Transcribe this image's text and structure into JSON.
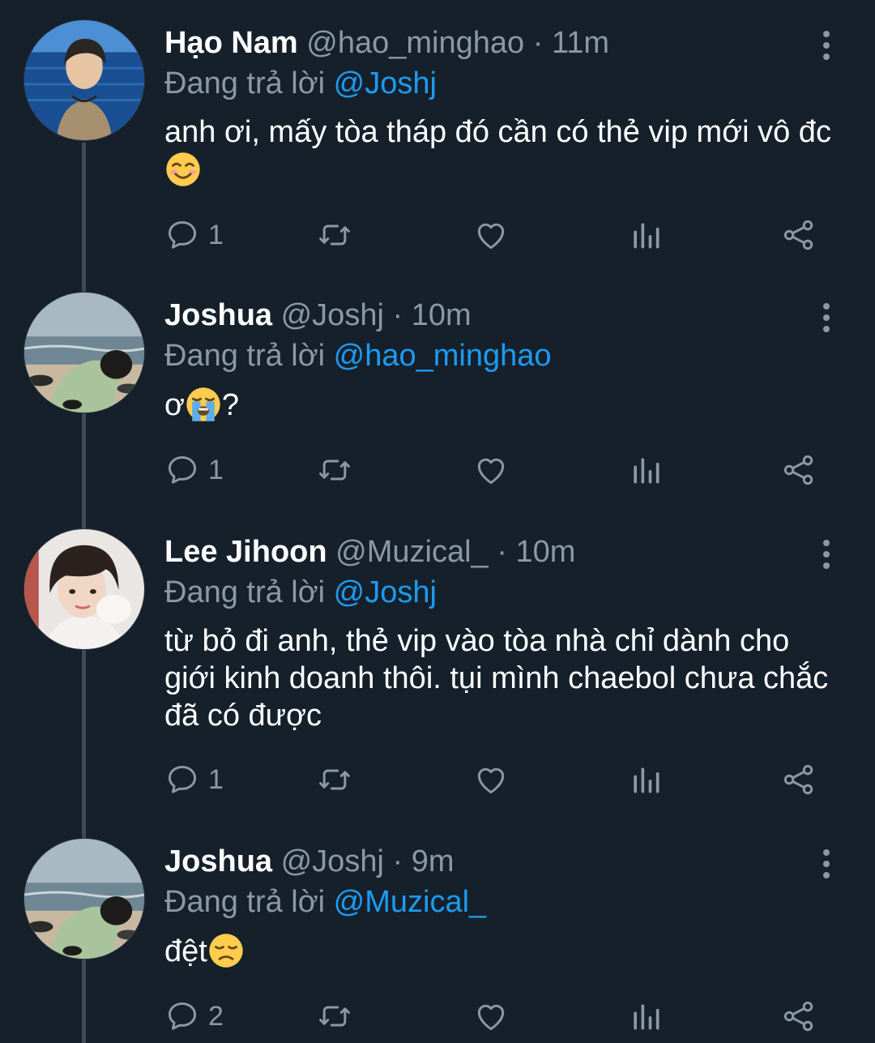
{
  "reply_prefix": "Đang trả lời",
  "dot": "·",
  "tweets": [
    {
      "name": "Hạo Nam",
      "handle": "@hao_minghao",
      "time": "11m",
      "reply_to": "@Joshj",
      "text": "anh ơi, mấy tòa tháp đó cần có thẻ vip mới vô đc",
      "emoji": "smiling-face-emoji",
      "reply_count": "1"
    },
    {
      "name": "Joshua",
      "handle": "@Joshj",
      "time": "10m",
      "reply_to": "@hao_minghao",
      "text_before": "ơ",
      "emoji": "crying-face-emoji",
      "text_after": "?",
      "reply_count": "1"
    },
    {
      "name": "Lee Jihoon",
      "handle": "@Muzical_",
      "time": "10m",
      "reply_to": "@Joshj",
      "text": "từ bỏ đi anh, thẻ vip vào tòa nhà chỉ dành cho giới kinh doanh thôi. tụi mình chaebol chưa chắc đã có được",
      "reply_count": "1"
    },
    {
      "name": "Joshua",
      "handle": "@Joshj",
      "time": "9m",
      "reply_to": "@Muzical_",
      "text": "đệt",
      "emoji": "disappointed-face-emoji",
      "reply_count": "2"
    }
  ],
  "colors": {
    "background": "#15202b",
    "muted": "#8b98a5",
    "mention": "#1d9bf0",
    "thread_line": "#3d4a57"
  }
}
